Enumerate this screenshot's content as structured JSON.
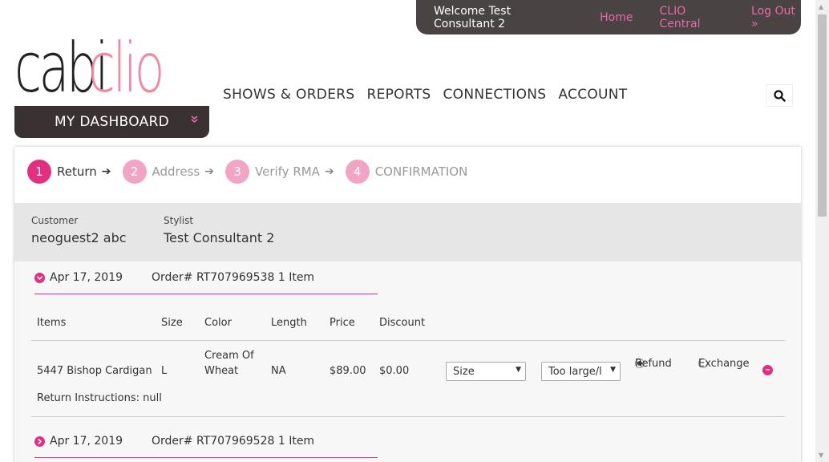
{
  "topbar": {
    "welcome": "Welcome Test Consultant 2",
    "home": "Home",
    "central": "CLIO Central",
    "logout": "Log Out »"
  },
  "logo": {
    "part1": "cabi",
    "part2": "clio"
  },
  "dashboard": {
    "label": "MY DASHBOARD",
    "chevron": "»"
  },
  "nav": {
    "items": [
      "SHOWS & ORDERS",
      "REPORTS",
      "CONNECTIONS",
      "ACCOUNT"
    ]
  },
  "steps": [
    {
      "num": "1",
      "label": "Return"
    },
    {
      "num": "2",
      "label": "Address"
    },
    {
      "num": "3",
      "label": "Verify RMA"
    },
    {
      "num": "4",
      "label": "CONFIRMATION"
    }
  ],
  "customer": {
    "customer_label": "Customer",
    "customer_value": "neoguest2 abc",
    "stylist_label": "Stylist",
    "stylist_value": "Test Consultant 2"
  },
  "orders": [
    {
      "date": "Apr 17, 2019",
      "order": "Order# RT707969538 1 Item",
      "expanded": true
    },
    {
      "date": "Apr 17, 2019",
      "order": "Order# RT707969528 1 Item",
      "expanded": false
    }
  ],
  "table": {
    "headers": {
      "items": "Items",
      "size": "Size",
      "color": "Color",
      "length": "Length",
      "price": "Price",
      "discount": "Discount"
    },
    "row": {
      "item": "5447 Bishop Cardigan",
      "size": "L",
      "color_line1": "Cream Of",
      "color_line2": "Wheat",
      "length": "NA",
      "price": "$89.00",
      "discount": "$0.00",
      "size_select": "Size",
      "reason_select": "Too large/l",
      "refund_label": "Refund",
      "exchange_label": "Exchange",
      "return_instructions": "Return Instructions: null"
    }
  },
  "colors": {
    "accent": "#e0307f",
    "accent_light": "#f2a4c6",
    "topbar": "#4a4343",
    "link": "#e86aa6",
    "logo_pink": "#f08aa5"
  }
}
